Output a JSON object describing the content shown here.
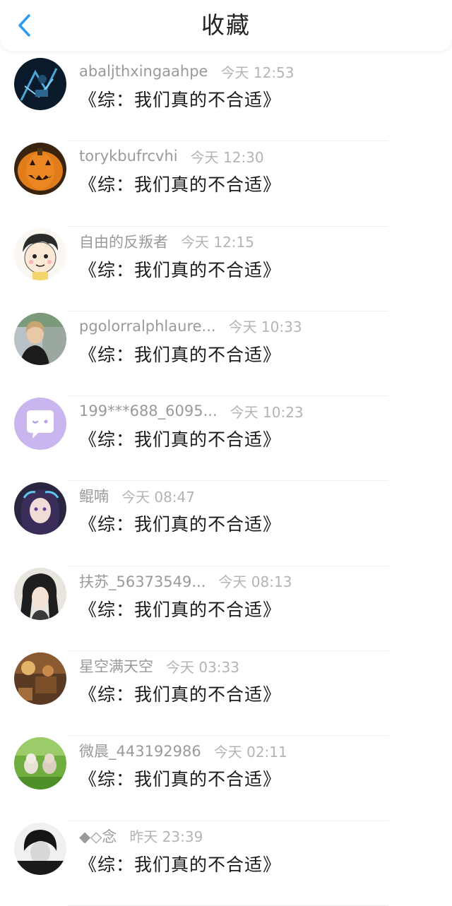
{
  "header": {
    "title": "收藏",
    "back_icon": "chevron-left-icon",
    "accent": "#2f9bf0"
  },
  "items": [
    {
      "name": "abaljthxingaahpe",
      "time": "今天 12:53",
      "book": "《综：我们真的不合适》",
      "avatar": "dark-abstract"
    },
    {
      "name": "torykbufrcvhi",
      "time": "今天 12:30",
      "book": "《综：我们真的不合适》",
      "avatar": "pumpkin"
    },
    {
      "name": "自由的反叛者",
      "time": "今天 12:15",
      "book": "《综：我们真的不合适》",
      "avatar": "cartoon-boy"
    },
    {
      "name": "pgolorralphlaure...",
      "time": "今天 10:33",
      "book": "《综：我们真的不合适》",
      "avatar": "woman-photo"
    },
    {
      "name": "199***688_6095...",
      "time": "今天 10:23",
      "book": "《综：我们真的不合适》",
      "avatar": "default-chat"
    },
    {
      "name": "鲲喃",
      "time": "今天 08:47",
      "book": "《综：我们真的不合适》",
      "avatar": "anime-girl"
    },
    {
      "name": "扶苏_56373549...",
      "time": "今天 08:13",
      "book": "《综：我们真的不合适》",
      "avatar": "anime-boy"
    },
    {
      "name": "星空满天空",
      "time": "今天 03:33",
      "book": "《综：我们真的不合适》",
      "avatar": "warm-illustration"
    },
    {
      "name": "微晨_443192986",
      "time": "今天 02:11",
      "book": "《综：我们真的不合适》",
      "avatar": "cats-grass"
    },
    {
      "name": "◆◇念",
      "time": "昨天 23:39",
      "book": "《综：我们真的不合适》",
      "avatar": "bw-portrait"
    }
  ]
}
